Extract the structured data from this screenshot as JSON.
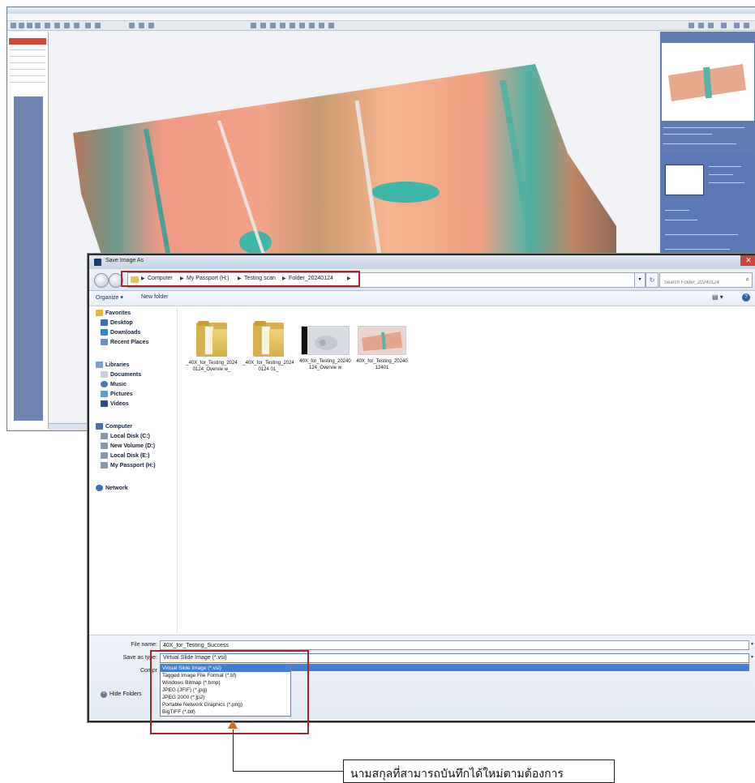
{
  "dialog": {
    "title": "Save Image As",
    "breadcrumbs": [
      "Computer",
      "My Passport (H:)",
      "Testing scan",
      "Folder_20240124"
    ],
    "search_placeholder": "Search Folder_20240124",
    "toolbar": {
      "organize": "Organize ▾",
      "new_folder": "New folder"
    },
    "nav": {
      "favorites": {
        "header": "Favorites",
        "items": [
          "Desktop",
          "Downloads",
          "Recent Places"
        ]
      },
      "libraries": {
        "header": "Libraries",
        "items": [
          "Documents",
          "Music",
          "Pictures",
          "Videos"
        ]
      },
      "computer": {
        "header": "Computer",
        "items": [
          "Local Disk (C:)",
          "New Volume (D:)",
          "Local Disk (E:)",
          "My Passport (H:)"
        ]
      },
      "network": {
        "header": "Network"
      }
    },
    "files": [
      {
        "label": "_40X_for_Testing_20240124_Overvie w_",
        "kind": "folder"
      },
      {
        "label": "_40X_for_Testing_20240124 01_",
        "kind": "folder"
      },
      {
        "label": "40X_for_Testing_20240124_Overvie w",
        "kind": "image"
      },
      {
        "label": "40X_for_Testing_2024012401",
        "kind": "image"
      }
    ],
    "filename_label": "File name:",
    "filename_value": "40X_for_Testing_Success",
    "savetype_label": "Save as type:",
    "savetype_value": "Virtual Slide Image (*.vsi)",
    "compress_label": "Compr",
    "type_options": [
      "Virtual Slide Image (*.vsi)",
      "Tagged Image File Format (*.tif)",
      "Windows Bitmap (*.bmp)",
      "JPEG (JFIF) (*.jpg)",
      "JPEG 2000 (*.jp2)",
      "Portable Network Graphics (*.png)",
      "BigTIFF (*.btf)"
    ],
    "hide_folders": "Hide Folders"
  },
  "annotation": {
    "callout_text": "นามสกุลที่สามารถบันทึกได้ใหม่ตามต้องการ",
    "highlight_color": "#a3272c",
    "arrow_color": "#cc6b2d"
  }
}
